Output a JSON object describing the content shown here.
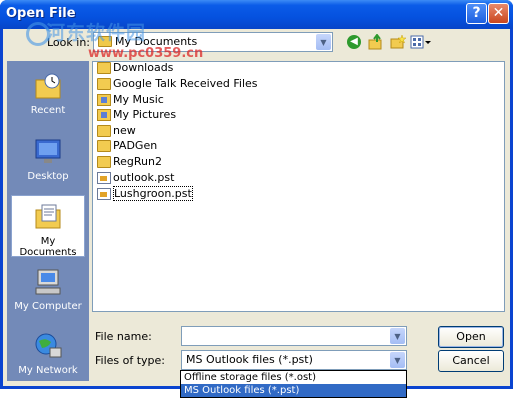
{
  "window": {
    "title": "Open File",
    "help_glyph": "?",
    "close_glyph": "✕"
  },
  "lookin": {
    "label": "Look in:",
    "value": "My Documents"
  },
  "places": [
    {
      "name": "recent",
      "label": "Recent"
    },
    {
      "name": "desktop",
      "label": "Desktop"
    },
    {
      "name": "my-documents",
      "label": "My Documents"
    },
    {
      "name": "my-computer",
      "label": "My Computer"
    },
    {
      "name": "my-network",
      "label": "My Network"
    }
  ],
  "files": [
    {
      "name": "Downloads",
      "kind": "folder"
    },
    {
      "name": "Google Talk Received Files",
      "kind": "folder"
    },
    {
      "name": "My Music",
      "kind": "special-folder"
    },
    {
      "name": "My Pictures",
      "kind": "special-folder"
    },
    {
      "name": "new",
      "kind": "folder"
    },
    {
      "name": "PADGen",
      "kind": "folder"
    },
    {
      "name": "RegRun2",
      "kind": "folder"
    },
    {
      "name": "outlook.pst",
      "kind": "pst"
    },
    {
      "name": "Lushgroon.pst",
      "kind": "pst"
    }
  ],
  "filename": {
    "label": "File name:",
    "value": ""
  },
  "filetype": {
    "label": "Files of type:",
    "value": "MS Outlook files (*.pst)",
    "options": [
      "Offline storage files (*.ost)",
      "MS Outlook files (*.pst)"
    ],
    "selected_index": 1
  },
  "buttons": {
    "open": "Open",
    "cancel": "Cancel"
  },
  "watermark": {
    "line1": "河东软件园",
    "line2": "www.pc0359.cn"
  },
  "colors": {
    "title_bar": "#0551df",
    "places_bar": "#738ab8",
    "selection": "#316ac5"
  }
}
